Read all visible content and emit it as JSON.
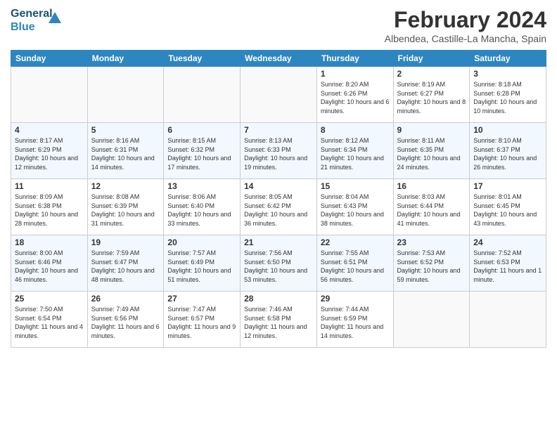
{
  "header": {
    "logo_line1": "General",
    "logo_line2": "Blue",
    "month_title": "February 2024",
    "location": "Albendea, Castille-La Mancha, Spain"
  },
  "days_of_week": [
    "Sunday",
    "Monday",
    "Tuesday",
    "Wednesday",
    "Thursday",
    "Friday",
    "Saturday"
  ],
  "weeks": [
    [
      {
        "day": "",
        "sunrise": "",
        "sunset": "",
        "daylight": ""
      },
      {
        "day": "",
        "sunrise": "",
        "sunset": "",
        "daylight": ""
      },
      {
        "day": "",
        "sunrise": "",
        "sunset": "",
        "daylight": ""
      },
      {
        "day": "",
        "sunrise": "",
        "sunset": "",
        "daylight": ""
      },
      {
        "day": "1",
        "sunrise": "Sunrise: 8:20 AM",
        "sunset": "Sunset: 6:26 PM",
        "daylight": "Daylight: 10 hours and 6 minutes."
      },
      {
        "day": "2",
        "sunrise": "Sunrise: 8:19 AM",
        "sunset": "Sunset: 6:27 PM",
        "daylight": "Daylight: 10 hours and 8 minutes."
      },
      {
        "day": "3",
        "sunrise": "Sunrise: 8:18 AM",
        "sunset": "Sunset: 6:28 PM",
        "daylight": "Daylight: 10 hours and 10 minutes."
      }
    ],
    [
      {
        "day": "4",
        "sunrise": "Sunrise: 8:17 AM",
        "sunset": "Sunset: 6:29 PM",
        "daylight": "Daylight: 10 hours and 12 minutes."
      },
      {
        "day": "5",
        "sunrise": "Sunrise: 8:16 AM",
        "sunset": "Sunset: 6:31 PM",
        "daylight": "Daylight: 10 hours and 14 minutes."
      },
      {
        "day": "6",
        "sunrise": "Sunrise: 8:15 AM",
        "sunset": "Sunset: 6:32 PM",
        "daylight": "Daylight: 10 hours and 17 minutes."
      },
      {
        "day": "7",
        "sunrise": "Sunrise: 8:13 AM",
        "sunset": "Sunset: 6:33 PM",
        "daylight": "Daylight: 10 hours and 19 minutes."
      },
      {
        "day": "8",
        "sunrise": "Sunrise: 8:12 AM",
        "sunset": "Sunset: 6:34 PM",
        "daylight": "Daylight: 10 hours and 21 minutes."
      },
      {
        "day": "9",
        "sunrise": "Sunrise: 8:11 AM",
        "sunset": "Sunset: 6:35 PM",
        "daylight": "Daylight: 10 hours and 24 minutes."
      },
      {
        "day": "10",
        "sunrise": "Sunrise: 8:10 AM",
        "sunset": "Sunset: 6:37 PM",
        "daylight": "Daylight: 10 hours and 26 minutes."
      }
    ],
    [
      {
        "day": "11",
        "sunrise": "Sunrise: 8:09 AM",
        "sunset": "Sunset: 6:38 PM",
        "daylight": "Daylight: 10 hours and 28 minutes."
      },
      {
        "day": "12",
        "sunrise": "Sunrise: 8:08 AM",
        "sunset": "Sunset: 6:39 PM",
        "daylight": "Daylight: 10 hours and 31 minutes."
      },
      {
        "day": "13",
        "sunrise": "Sunrise: 8:06 AM",
        "sunset": "Sunset: 6:40 PM",
        "daylight": "Daylight: 10 hours and 33 minutes."
      },
      {
        "day": "14",
        "sunrise": "Sunrise: 8:05 AM",
        "sunset": "Sunset: 6:42 PM",
        "daylight": "Daylight: 10 hours and 36 minutes."
      },
      {
        "day": "15",
        "sunrise": "Sunrise: 8:04 AM",
        "sunset": "Sunset: 6:43 PM",
        "daylight": "Daylight: 10 hours and 38 minutes."
      },
      {
        "day": "16",
        "sunrise": "Sunrise: 8:03 AM",
        "sunset": "Sunset: 6:44 PM",
        "daylight": "Daylight: 10 hours and 41 minutes."
      },
      {
        "day": "17",
        "sunrise": "Sunrise: 8:01 AM",
        "sunset": "Sunset: 6:45 PM",
        "daylight": "Daylight: 10 hours and 43 minutes."
      }
    ],
    [
      {
        "day": "18",
        "sunrise": "Sunrise: 8:00 AM",
        "sunset": "Sunset: 6:46 PM",
        "daylight": "Daylight: 10 hours and 46 minutes."
      },
      {
        "day": "19",
        "sunrise": "Sunrise: 7:59 AM",
        "sunset": "Sunset: 6:47 PM",
        "daylight": "Daylight: 10 hours and 48 minutes."
      },
      {
        "day": "20",
        "sunrise": "Sunrise: 7:57 AM",
        "sunset": "Sunset: 6:49 PM",
        "daylight": "Daylight: 10 hours and 51 minutes."
      },
      {
        "day": "21",
        "sunrise": "Sunrise: 7:56 AM",
        "sunset": "Sunset: 6:50 PM",
        "daylight": "Daylight: 10 hours and 53 minutes."
      },
      {
        "day": "22",
        "sunrise": "Sunrise: 7:55 AM",
        "sunset": "Sunset: 6:51 PM",
        "daylight": "Daylight: 10 hours and 56 minutes."
      },
      {
        "day": "23",
        "sunrise": "Sunrise: 7:53 AM",
        "sunset": "Sunset: 6:52 PM",
        "daylight": "Daylight: 10 hours and 59 minutes."
      },
      {
        "day": "24",
        "sunrise": "Sunrise: 7:52 AM",
        "sunset": "Sunset: 6:53 PM",
        "daylight": "Daylight: 11 hours and 1 minute."
      }
    ],
    [
      {
        "day": "25",
        "sunrise": "Sunrise: 7:50 AM",
        "sunset": "Sunset: 6:54 PM",
        "daylight": "Daylight: 11 hours and 4 minutes."
      },
      {
        "day": "26",
        "sunrise": "Sunrise: 7:49 AM",
        "sunset": "Sunset: 6:56 PM",
        "daylight": "Daylight: 11 hours and 6 minutes."
      },
      {
        "day": "27",
        "sunrise": "Sunrise: 7:47 AM",
        "sunset": "Sunset: 6:57 PM",
        "daylight": "Daylight: 11 hours and 9 minutes."
      },
      {
        "day": "28",
        "sunrise": "Sunrise: 7:46 AM",
        "sunset": "Sunset: 6:58 PM",
        "daylight": "Daylight: 11 hours and 12 minutes."
      },
      {
        "day": "29",
        "sunrise": "Sunrise: 7:44 AM",
        "sunset": "Sunset: 6:59 PM",
        "daylight": "Daylight: 11 hours and 14 minutes."
      },
      {
        "day": "",
        "sunrise": "",
        "sunset": "",
        "daylight": ""
      },
      {
        "day": "",
        "sunrise": "",
        "sunset": "",
        "daylight": ""
      }
    ]
  ]
}
